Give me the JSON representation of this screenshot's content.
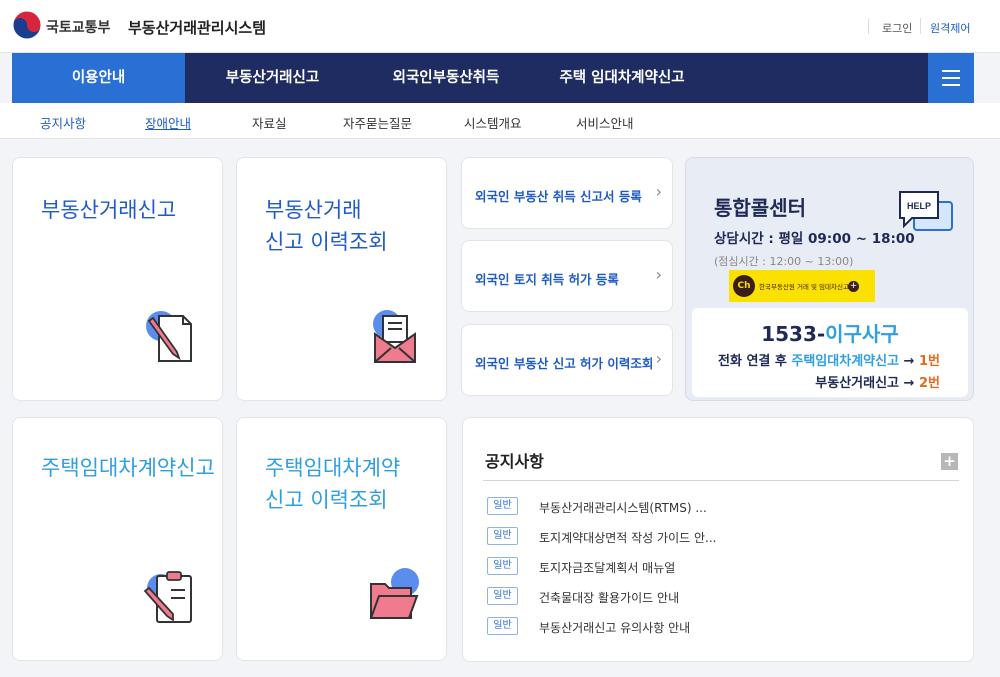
{
  "header": {
    "ministry": "국토교통부",
    "system_title": "부동산거래관리시스템",
    "login": "로그인",
    "remote": "원격제어"
  },
  "gnb": {
    "items": [
      {
        "label": "이용안내"
      },
      {
        "label": "부동산거래신고"
      },
      {
        "label": "외국인부동산취득"
      },
      {
        "label": "주택 임대차계약신고"
      }
    ],
    "active_index": 0
  },
  "snb": {
    "items": [
      {
        "label": "공지사항"
      },
      {
        "label": "장애안내"
      },
      {
        "label": "자료실"
      },
      {
        "label": "자주묻는질문"
      },
      {
        "label": "시스템개요"
      },
      {
        "label": "서비스안내"
      }
    ]
  },
  "cards": {
    "trade_report": "부동산거래신고",
    "trade_history": "부동산거래\n신고 이력조회",
    "lease_report": "주택임대차계약신고",
    "lease_history": "주택임대차계약\n신고 이력조회"
  },
  "links": [
    {
      "label": "외국인 부동산 취득 신고서 등록"
    },
    {
      "label": "외국인 토지 취득 허가 등록"
    },
    {
      "label": "외국인 부동산 신고 허가 이력조회"
    }
  ],
  "call_center": {
    "title": "통합콜센터",
    "hours": "상담시간 : 평일 09:00 ~ 18:00",
    "lunch": "(점심시간 : 12:00 ~ 13:00)",
    "kakao_badge": "Ch",
    "kakao_text": "한국부동산원 거래 및 임대차신고",
    "number_main": "1533-",
    "number_word": "이구사구",
    "line1_prefix": "전화 연결 후 ",
    "line1_service": "주택임대차계약신고",
    "line1_arrow": " → ",
    "line1_no": "1번",
    "line2_service": "부동산거래신고",
    "line2_arrow": " → ",
    "line2_no": "2번",
    "help_label": "HELP"
  },
  "notice": {
    "title": "공지사항",
    "more": "+",
    "items": [
      {
        "badge": "일반",
        "text": "부동산거래관리시스템(RTMS) ..."
      },
      {
        "badge": "일반",
        "text": "토지계약대상면적 작성 가이드 안..."
      },
      {
        "badge": "일반",
        "text": "토지자금조달계획서 매뉴얼"
      },
      {
        "badge": "일반",
        "text": "건축물대장 활용가이드 안내"
      },
      {
        "badge": "일반",
        "text": "부동산거래신고 유의사항 안내"
      }
    ]
  },
  "colors": {
    "nav_bg": "#1e2c62",
    "nav_active": "#2a6fd4",
    "text_blue": "#1f5bc7",
    "text_sky": "#2f9fe0",
    "accent_orange": "#e46b1f",
    "kakao_yellow": "#fae100"
  },
  "icons": {
    "logo": "korea-taegeuk-logo-icon",
    "menu": "hamburger-menu-icon",
    "document": "document-pen-icon",
    "mail": "envelope-letter-icon",
    "clipboard": "clipboard-pen-icon",
    "folder": "open-folder-icon",
    "help": "help-speech-bubble-icon"
  }
}
